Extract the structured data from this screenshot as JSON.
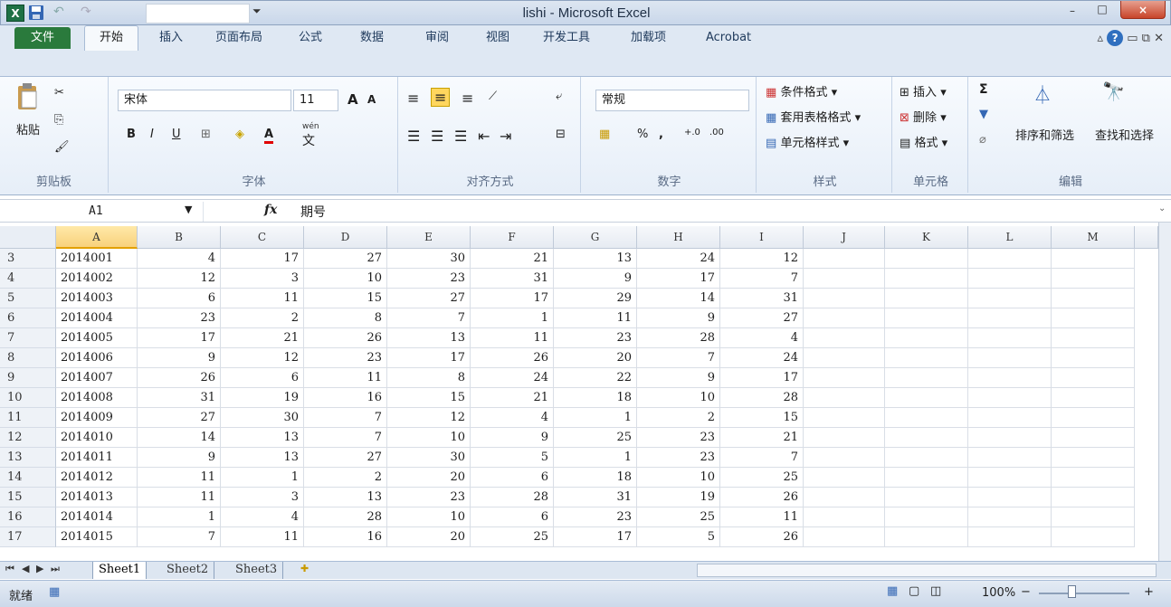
{
  "window": {
    "title": "lishi - Microsoft Excel",
    "logo_text": "X",
    "minimize": "–",
    "maximize": "□",
    "close": "×"
  },
  "tabs": {
    "file": "文件",
    "items": [
      "开始",
      "插入",
      "页面布局",
      "公式",
      "数据",
      "审阅",
      "视图",
      "开发工具",
      "加载项",
      "Acrobat"
    ]
  },
  "ribbon": {
    "clipboard": {
      "paste": "粘贴",
      "label": "剪贴板"
    },
    "font": {
      "name": "宋体",
      "size": "11",
      "bold": "B",
      "italic": "I",
      "underline": "U",
      "grow": "A",
      "shrink": "A",
      "font_color": "A",
      "phonetic": "wén",
      "phonetic_char": "文",
      "label": "字体"
    },
    "alignment": {
      "label": "对齐方式"
    },
    "number": {
      "format": "常规",
      "percent": "%",
      "comma": ",",
      "label": "数字"
    },
    "styles": {
      "conditional": "条件格式",
      "table": "套用表格格式",
      "cell": "单元格样式",
      "label": "样式"
    },
    "cells": {
      "insert": "插入",
      "delete": "删除",
      "format": "格式",
      "label": "单元格"
    },
    "editing": {
      "sum": "Σ",
      "sort": "排序和筛选",
      "find": "查找和选择",
      "label": "编辑"
    }
  },
  "formula_bar": {
    "name_box": "A1",
    "fx": "fx",
    "content": "期号"
  },
  "columns": [
    "A",
    "B",
    "C",
    "D",
    "E",
    "F",
    "G",
    "H",
    "I",
    "J",
    "K",
    "L",
    "M"
  ],
  "rows": [
    {
      "num": "3",
      "cells": [
        "2014001",
        "4",
        "17",
        "27",
        "30",
        "21",
        "13",
        "24",
        "12"
      ]
    },
    {
      "num": "4",
      "cells": [
        "2014002",
        "12",
        "3",
        "10",
        "23",
        "31",
        "9",
        "17",
        "7"
      ]
    },
    {
      "num": "5",
      "cells": [
        "2014003",
        "6",
        "11",
        "15",
        "27",
        "17",
        "29",
        "14",
        "31"
      ]
    },
    {
      "num": "6",
      "cells": [
        "2014004",
        "23",
        "2",
        "8",
        "7",
        "1",
        "11",
        "9",
        "27"
      ]
    },
    {
      "num": "7",
      "cells": [
        "2014005",
        "17",
        "21",
        "26",
        "13",
        "11",
        "23",
        "28",
        "4"
      ]
    },
    {
      "num": "8",
      "cells": [
        "2014006",
        "9",
        "12",
        "23",
        "17",
        "26",
        "20",
        "7",
        "24"
      ]
    },
    {
      "num": "9",
      "cells": [
        "2014007",
        "26",
        "6",
        "11",
        "8",
        "24",
        "22",
        "9",
        "17"
      ]
    },
    {
      "num": "10",
      "cells": [
        "2014008",
        "31",
        "19",
        "16",
        "15",
        "21",
        "18",
        "10",
        "28"
      ]
    },
    {
      "num": "11",
      "cells": [
        "2014009",
        "27",
        "30",
        "7",
        "12",
        "4",
        "1",
        "2",
        "15"
      ]
    },
    {
      "num": "12",
      "cells": [
        "2014010",
        "14",
        "13",
        "7",
        "10",
        "9",
        "25",
        "23",
        "21"
      ]
    },
    {
      "num": "13",
      "cells": [
        "2014011",
        "9",
        "13",
        "27",
        "30",
        "5",
        "1",
        "23",
        "7"
      ]
    },
    {
      "num": "14",
      "cells": [
        "2014012",
        "11",
        "1",
        "2",
        "20",
        "6",
        "18",
        "10",
        "25"
      ]
    },
    {
      "num": "15",
      "cells": [
        "2014013",
        "11",
        "3",
        "13",
        "23",
        "28",
        "31",
        "19",
        "26"
      ]
    },
    {
      "num": "16",
      "cells": [
        "2014014",
        "1",
        "4",
        "28",
        "10",
        "6",
        "23",
        "25",
        "11"
      ]
    },
    {
      "num": "17",
      "cells": [
        "2014015",
        "7",
        "11",
        "16",
        "20",
        "25",
        "17",
        "5",
        "26"
      ]
    }
  ],
  "sheets": [
    "Sheet1",
    "Sheet2",
    "Sheet3"
  ],
  "status": {
    "ready": "就绪",
    "zoom": "100%",
    "zoom_out": "−",
    "zoom_in": "+"
  },
  "colors": {
    "file_tab": "#2a7a3c",
    "close_button": "#c8442a",
    "active_header": "#f8d27c"
  }
}
